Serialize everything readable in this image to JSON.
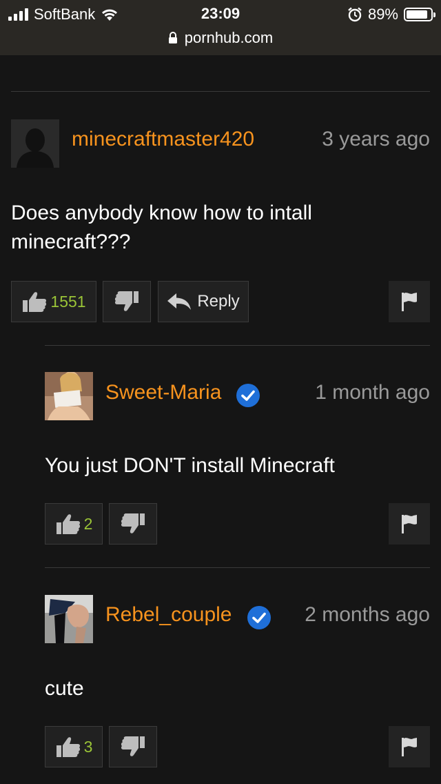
{
  "status_bar": {
    "carrier": "SoftBank",
    "time": "23:09",
    "battery": "89%",
    "battery_level": 0.89,
    "url": "pornhub.com"
  },
  "colors": {
    "username": "#f7931e",
    "like_count": "#9ac437",
    "verified": "#1f6fd8",
    "background": "#151515"
  },
  "comments": [
    {
      "username": "minecraftmaster420",
      "time": "3 years ago",
      "text": "Does anybody know how to intall minecraft???",
      "likes": "1551",
      "reply_label": "Reply",
      "verified": false
    },
    {
      "username": "Sweet-Maria",
      "time": "1 month ago",
      "text": "You just DON'T install Minecraft",
      "likes": "2",
      "verified": true
    },
    {
      "username": "Rebel_couple",
      "time": "2 months ago",
      "text": "cute",
      "likes": "3",
      "verified": true
    }
  ],
  "icons": [
    "thumbs-up-icon",
    "thumbs-down-icon",
    "reply-arrow-icon",
    "flag-icon",
    "verified-check-icon",
    "lock-icon",
    "alarm-icon",
    "wifi-icon",
    "signal-icon",
    "battery-icon"
  ]
}
